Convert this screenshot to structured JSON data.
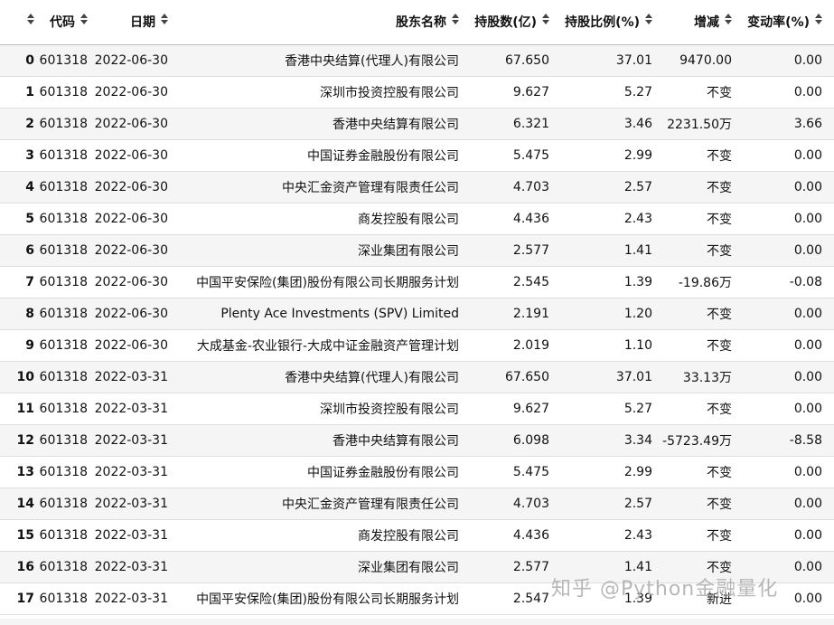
{
  "table": {
    "columns": [
      {
        "key": "idx",
        "label": ""
      },
      {
        "key": "code",
        "label": "代码"
      },
      {
        "key": "date",
        "label": "日期"
      },
      {
        "key": "name",
        "label": "股东名称"
      },
      {
        "key": "hold",
        "label": "持股数(亿)"
      },
      {
        "key": "ratio",
        "label": "持股比例(%)"
      },
      {
        "key": "chg",
        "label": "增减"
      },
      {
        "key": "rate",
        "label": "变动率(%)"
      }
    ],
    "rows": [
      {
        "idx": "0",
        "code": "601318",
        "date": "2022-06-30",
        "name": "香港中央结算(代理人)有限公司",
        "hold": "67.650",
        "ratio": "37.01",
        "chg": "9470.00",
        "rate": "0.00"
      },
      {
        "idx": "1",
        "code": "601318",
        "date": "2022-06-30",
        "name": "深圳市投资控股有限公司",
        "hold": "9.627",
        "ratio": "5.27",
        "chg": "不变",
        "rate": "0.00"
      },
      {
        "idx": "2",
        "code": "601318",
        "date": "2022-06-30",
        "name": "香港中央结算有限公司",
        "hold": "6.321",
        "ratio": "3.46",
        "chg": "2231.50万",
        "rate": "3.66"
      },
      {
        "idx": "3",
        "code": "601318",
        "date": "2022-06-30",
        "name": "中国证券金融股份有限公司",
        "hold": "5.475",
        "ratio": "2.99",
        "chg": "不变",
        "rate": "0.00"
      },
      {
        "idx": "4",
        "code": "601318",
        "date": "2022-06-30",
        "name": "中央汇金资产管理有限责任公司",
        "hold": "4.703",
        "ratio": "2.57",
        "chg": "不变",
        "rate": "0.00"
      },
      {
        "idx": "5",
        "code": "601318",
        "date": "2022-06-30",
        "name": "商发控股有限公司",
        "hold": "4.436",
        "ratio": "2.43",
        "chg": "不变",
        "rate": "0.00"
      },
      {
        "idx": "6",
        "code": "601318",
        "date": "2022-06-30",
        "name": "深业集团有限公司",
        "hold": "2.577",
        "ratio": "1.41",
        "chg": "不变",
        "rate": "0.00"
      },
      {
        "idx": "7",
        "code": "601318",
        "date": "2022-06-30",
        "name": "中国平安保险(集团)股份有限公司长期服务计划",
        "hold": "2.545",
        "ratio": "1.39",
        "chg": "-19.86万",
        "rate": "-0.08"
      },
      {
        "idx": "8",
        "code": "601318",
        "date": "2022-06-30",
        "name": "Plenty Ace Investments (SPV) Limited",
        "hold": "2.191",
        "ratio": "1.20",
        "chg": "不变",
        "rate": "0.00"
      },
      {
        "idx": "9",
        "code": "601318",
        "date": "2022-06-30",
        "name": "大成基金-农业银行-大成中证金融资产管理计划",
        "hold": "2.019",
        "ratio": "1.10",
        "chg": "不变",
        "rate": "0.00"
      },
      {
        "idx": "10",
        "code": "601318",
        "date": "2022-03-31",
        "name": "香港中央结算(代理人)有限公司",
        "hold": "67.650",
        "ratio": "37.01",
        "chg": "33.13万",
        "rate": "0.00"
      },
      {
        "idx": "11",
        "code": "601318",
        "date": "2022-03-31",
        "name": "深圳市投资控股有限公司",
        "hold": "9.627",
        "ratio": "5.27",
        "chg": "不变",
        "rate": "0.00"
      },
      {
        "idx": "12",
        "code": "601318",
        "date": "2022-03-31",
        "name": "香港中央结算有限公司",
        "hold": "6.098",
        "ratio": "3.34",
        "chg": "-5723.49万",
        "rate": "-8.58"
      },
      {
        "idx": "13",
        "code": "601318",
        "date": "2022-03-31",
        "name": "中国证券金融股份有限公司",
        "hold": "5.475",
        "ratio": "2.99",
        "chg": "不变",
        "rate": "0.00"
      },
      {
        "idx": "14",
        "code": "601318",
        "date": "2022-03-31",
        "name": "中央汇金资产管理有限责任公司",
        "hold": "4.703",
        "ratio": "2.57",
        "chg": "不变",
        "rate": "0.00"
      },
      {
        "idx": "15",
        "code": "601318",
        "date": "2022-03-31",
        "name": "商发控股有限公司",
        "hold": "4.436",
        "ratio": "2.43",
        "chg": "不变",
        "rate": "0.00"
      },
      {
        "idx": "16",
        "code": "601318",
        "date": "2022-03-31",
        "name": "深业集团有限公司",
        "hold": "2.577",
        "ratio": "1.41",
        "chg": "不变",
        "rate": "0.00"
      },
      {
        "idx": "17",
        "code": "601318",
        "date": "2022-03-31",
        "name": "中国平安保险(集团)股份有限公司长期服务计划",
        "hold": "2.547",
        "ratio": "1.39",
        "chg": "新进",
        "rate": "0.00"
      }
    ]
  },
  "watermark": "知乎 @Python金融量化",
  "icons": {
    "sort": "sort-icon"
  },
  "colors": {
    "row_alt": "#f5f5f5",
    "border": "#dedede",
    "text": "#111111"
  }
}
